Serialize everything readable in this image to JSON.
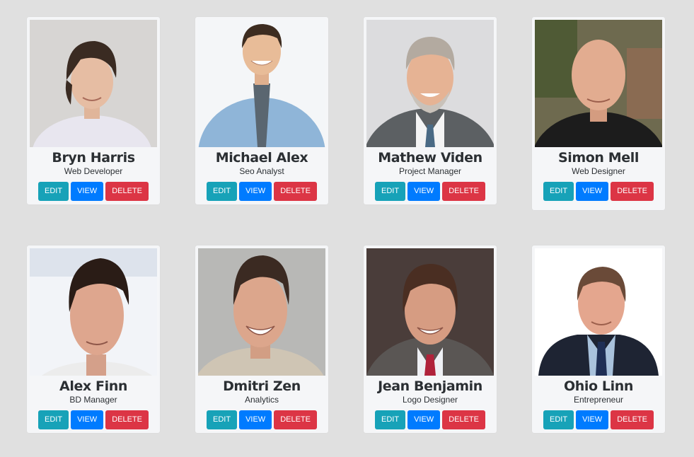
{
  "colors": {
    "background": "#e0e0e0",
    "card": "#f5f6f8",
    "edit": "#17a2b8",
    "view": "#007bff",
    "delete": "#dc3545"
  },
  "buttons": {
    "edit": "EDIT",
    "view": "VIEW",
    "delete": "DELETE"
  },
  "team": [
    {
      "name": "Bryn Harris",
      "role": "Web Developer"
    },
    {
      "name": "Michael Alex",
      "role": "Seo Analyst"
    },
    {
      "name": "Mathew Viden",
      "role": "Project Manager"
    },
    {
      "name": "Simon Mell",
      "role": "Web Designer"
    },
    {
      "name": "Alex Finn",
      "role": "BD Manager"
    },
    {
      "name": "Dmitri Zen",
      "role": "Analytics"
    },
    {
      "name": "Jean Benjamin",
      "role": "Logo Designer"
    },
    {
      "name": "Ohio Linn",
      "role": "Entrepreneur"
    }
  ]
}
